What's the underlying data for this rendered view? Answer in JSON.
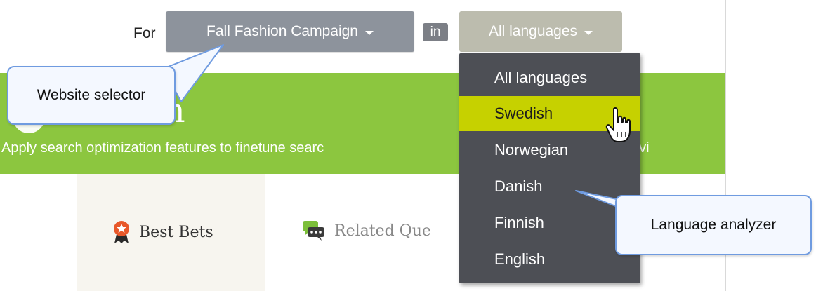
{
  "toolbar": {
    "for_label": "For",
    "website_selector_label": "Fall Fashion Campaign",
    "in_label": "in",
    "language_selector_label": "All languages"
  },
  "banner": {
    "title_fragment": "ization",
    "subtitle_left": "Apply search optimization features to finetune searc",
    "subtitle_right": "elping vi"
  },
  "tabs": [
    {
      "label": "Best Bets",
      "icon": "ribbon-star-icon"
    },
    {
      "label": "Related Que",
      "icon": "chat-bubble-icon"
    }
  ],
  "language_menu": {
    "items": [
      {
        "label": "All languages",
        "selected": false
      },
      {
        "label": "Swedish",
        "selected": true
      },
      {
        "label": "Norwegian",
        "selected": false
      },
      {
        "label": "Danish",
        "selected": false
      },
      {
        "label": "Finnish",
        "selected": false
      },
      {
        "label": "English",
        "selected": false
      }
    ]
  },
  "callouts": {
    "website_selector": "Website selector",
    "language_analyzer": "Language analyzer"
  },
  "colors": {
    "banner_green": "#8cc63f",
    "menu_bg": "#4d4f55",
    "menu_selected": "#c6d100",
    "callout_border": "#6f9be0"
  }
}
